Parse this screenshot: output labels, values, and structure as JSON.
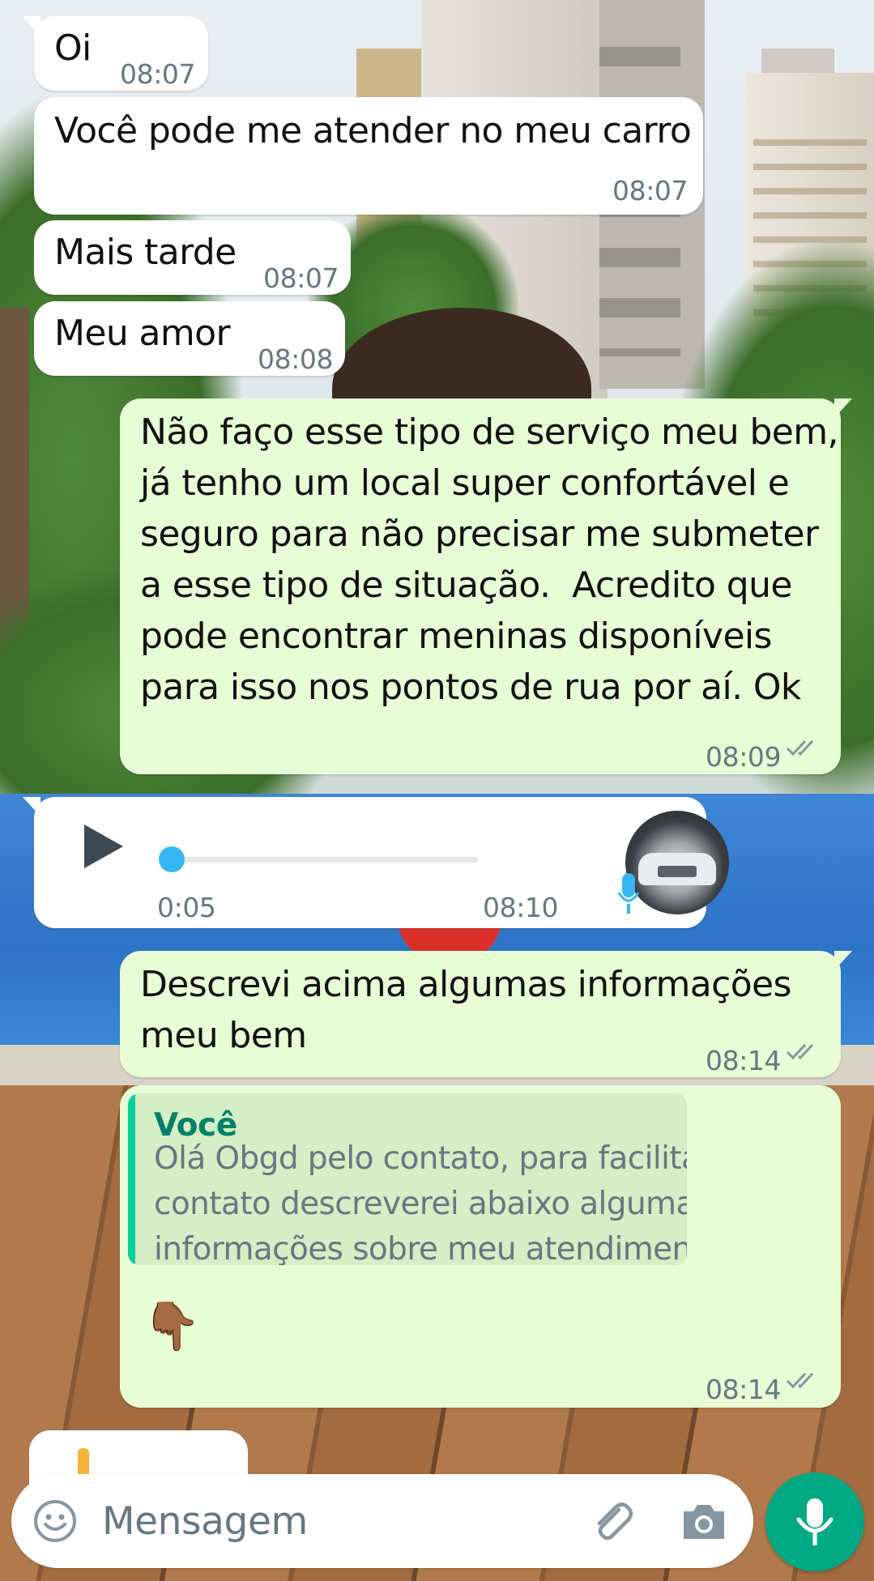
{
  "messages": [
    {
      "id": "m1",
      "direction": "incoming",
      "text": "Oi",
      "time": "08:07"
    },
    {
      "id": "m2",
      "direction": "incoming",
      "text": "Você pode me atender no meu carro",
      "time": "08:07"
    },
    {
      "id": "m3",
      "direction": "incoming",
      "text": "Mais tarde",
      "time": "08:07"
    },
    {
      "id": "m4",
      "direction": "incoming",
      "text": "Meu amor",
      "time": "08:08"
    },
    {
      "id": "m5",
      "direction": "outgoing",
      "lines": [
        "Não faço esse tipo de serviço meu bem,",
        "já tenho um local super confortável e",
        "seguro para não precisar me submeter",
        "a esse tipo de situação.  Acredito que",
        "pode encontrar meninas disponíveis",
        "para isso nos pontos de rua por aí. Ok"
      ],
      "time": "08:09",
      "status": "delivered"
    },
    {
      "id": "m6",
      "direction": "incoming",
      "type": "voice",
      "duration": "0:05",
      "time": "08:10",
      "progress": 0
    },
    {
      "id": "m7",
      "direction": "outgoing",
      "lines": [
        "Descrevi acima algumas informações",
        "meu bem"
      ],
      "time": "08:14",
      "status": "delivered"
    },
    {
      "id": "m8",
      "direction": "outgoing",
      "quote": {
        "author": "Você",
        "lines": [
          "Olá Obgd pelo contato, para facilitar nosso",
          "contato descreverei abaixo algumas",
          "informações sobre meu atendimento. Peç..."
        ]
      },
      "text": "👇🏾",
      "time": "08:14",
      "status": "delivered"
    }
  ],
  "composer": {
    "placeholder": "Mensagem",
    "icons": [
      "emoji-icon",
      "attach-icon",
      "camera-icon",
      "mic-icon"
    ]
  },
  "colors": {
    "incoming_bubble": "#ffffff",
    "outgoing_bubble": "#e7fdd6",
    "accent": "#00a884",
    "quote_author": "#008069",
    "voice_progress": "#34b7f1",
    "meta_text": "#667781"
  }
}
